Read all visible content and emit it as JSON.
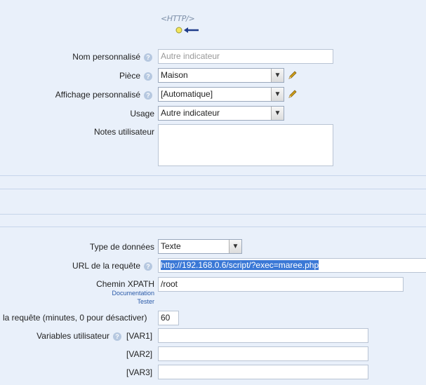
{
  "logo": {
    "text": "<HTTP/>"
  },
  "fields": {
    "nom": {
      "label": "Nom personnalisé",
      "placeholder": "Autre indicateur"
    },
    "piece": {
      "label": "Pièce",
      "value": "Maison"
    },
    "affichage": {
      "label": "Affichage personnalisé",
      "value": "[Automatique]"
    },
    "usage": {
      "label": "Usage",
      "value": "Autre indicateur"
    },
    "notes": {
      "label": "Notes utilisateur",
      "value": ""
    },
    "type": {
      "label": "Type de données",
      "value": "Texte"
    },
    "url": {
      "label": "URL de la requête",
      "value": "http://192.168.0.6/script/?exec=maree.php"
    },
    "xpath": {
      "label": "Chemin XPATH",
      "value": "/root",
      "doc_link": "Documentation",
      "test_link": "Tester"
    },
    "interval": {
      "label": "la requête (minutes, 0 pour désactiver)",
      "value": "60"
    },
    "vars": {
      "label": "Variables utilisateur",
      "var1": "[VAR1]",
      "var2": "[VAR2]",
      "var3": "[VAR3]"
    }
  },
  "icons": {
    "help": "?",
    "dropdown_arrow": "▼",
    "back_arrow": "arrow-left-icon",
    "edit": "pencil-icon"
  }
}
